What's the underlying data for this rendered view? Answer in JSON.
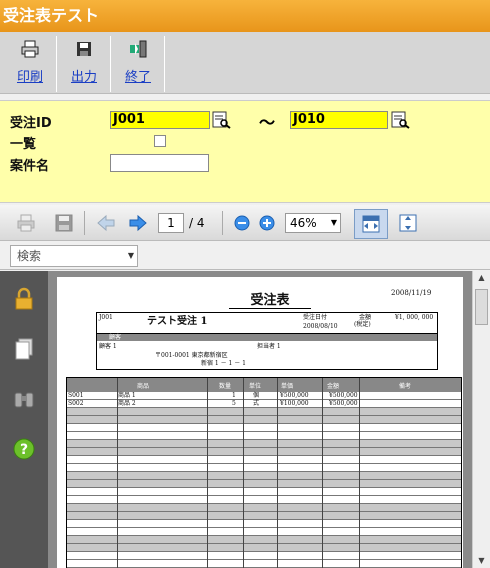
{
  "window": {
    "title": "受注表テスト"
  },
  "toolbar": {
    "print_label": "印刷",
    "output_label": "出力",
    "exit_label": "終了"
  },
  "form": {
    "order_id_label": "受注ID",
    "order_id_from": "J001",
    "range_sep": "～",
    "order_id_to": "J010",
    "list_label": "一覧",
    "case_name_label": "案件名",
    "case_name_value": ""
  },
  "report_toolbar": {
    "page_current": "1",
    "page_total": "/ 4",
    "zoom": "46%"
  },
  "search": {
    "label": "検索"
  },
  "report_page": {
    "title": "受注表",
    "date": "2008/11/19",
    "order_id": "J001",
    "order_name": "テスト受注 1",
    "order_date_label": "受注日付",
    "order_date": "2008/08/10",
    "amount_label": "金額",
    "amount_sub": "(税定)",
    "amount": "¥1, 000, 000",
    "customer_header": "顧客",
    "customer": "顧客 1",
    "contact": "担当者 1",
    "postal": "〒001-0001  東京都新宿区",
    "address": "新宿 1 － 1 － 1",
    "table_headers": [
      "商品",
      "数量",
      "単位",
      "単価",
      "金額",
      "備考"
    ],
    "rows": [
      [
        "S001",
        "商品 1",
        "1",
        "個",
        "¥500,000",
        "¥500,000"
      ],
      [
        "S002",
        "商品 2",
        "5",
        "式",
        "¥100,000",
        "¥500,000"
      ]
    ]
  }
}
